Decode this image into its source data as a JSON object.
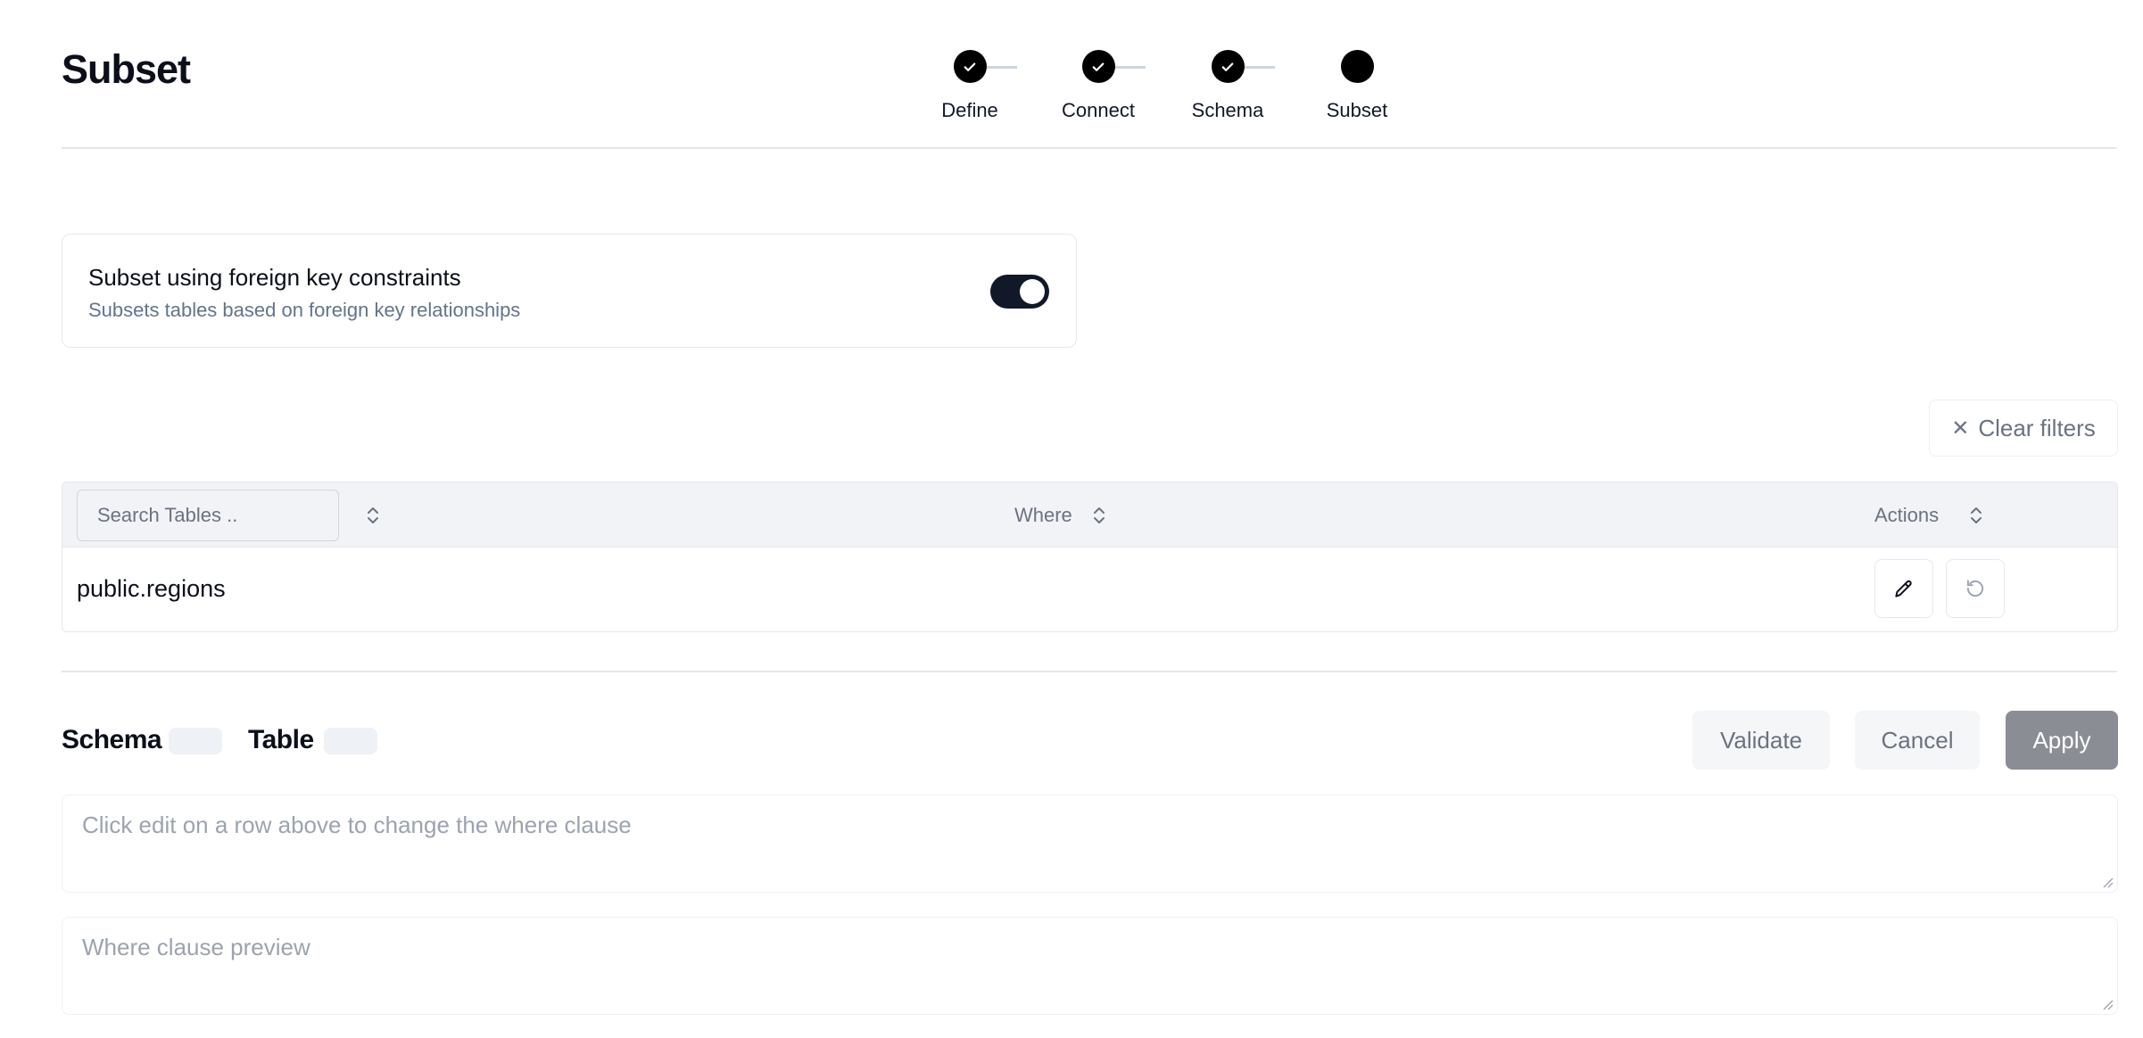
{
  "page": {
    "title": "Subset"
  },
  "stepper": {
    "steps": [
      {
        "label": "Define",
        "completed": true
      },
      {
        "label": "Connect",
        "completed": true
      },
      {
        "label": "Schema",
        "completed": true
      },
      {
        "label": "Subset",
        "completed": false,
        "current": true
      }
    ]
  },
  "fk_setting": {
    "title": "Subset using foreign key constraints",
    "description": "Subsets tables based on foreign key relationships",
    "enabled": true
  },
  "filters": {
    "clear_label": "Clear filters"
  },
  "table": {
    "search_placeholder": "Search Tables ..",
    "columns": {
      "where": "Where",
      "actions": "Actions"
    },
    "rows": [
      {
        "table": "public.regions",
        "where": ""
      }
    ]
  },
  "editor": {
    "schema_label": "Schema",
    "schema_value": "",
    "table_label": "Table",
    "table_value": "",
    "validate_label": "Validate",
    "cancel_label": "Cancel",
    "apply_label": "Apply",
    "where_placeholder": "Click edit on a row above to change the where clause",
    "preview_placeholder": "Where clause preview"
  },
  "colors": {
    "toggle_on": "#111827",
    "apply_button": "#8a8d94",
    "header_bg": "#f1f3f7"
  }
}
